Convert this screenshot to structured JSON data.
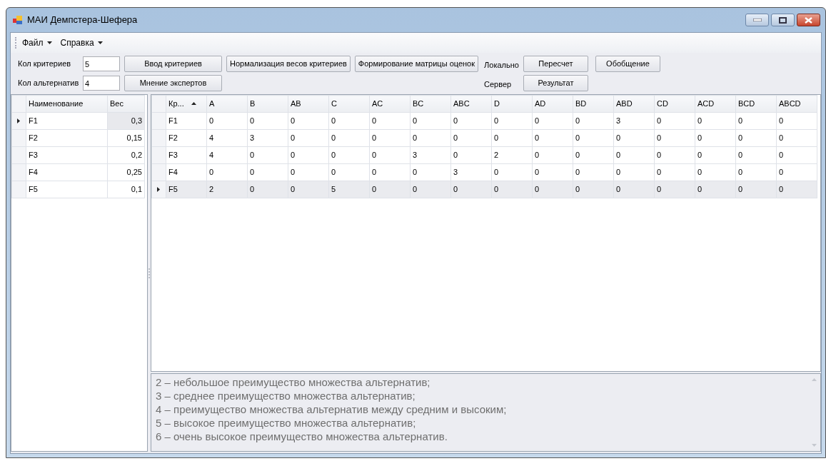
{
  "window": {
    "title": "МАИ Демпстера-Шефера"
  },
  "menu": [
    {
      "label": "Файл"
    },
    {
      "label": "Справка"
    }
  ],
  "fields": [
    {
      "label": "Кол критериев",
      "value": "5"
    },
    {
      "label": "Кол альтернатив",
      "value": "4"
    }
  ],
  "buttons": {
    "input_criteria": "Ввод критериев",
    "experts": "Мнение экспертов",
    "normalize": "Нормализация весов критериев",
    "matrix": "Формирование матрицы оценок",
    "local_label": "Локально",
    "server_label": "Сервер",
    "recalc": "Пересчет",
    "result": "Результат",
    "summary": "Обобщение"
  },
  "criteria_grid": {
    "columns": [
      "Наименование",
      "Вес"
    ],
    "rows": [
      {
        "current": true,
        "cells": [
          {
            "text": "F1",
            "selected": false
          },
          {
            "text": "0,3",
            "selected": true
          }
        ]
      },
      {
        "current": false,
        "cells": [
          {
            "text": "F2",
            "selected": false
          },
          {
            "text": "0,15",
            "selected": false
          }
        ]
      },
      {
        "current": false,
        "cells": [
          {
            "text": "F3",
            "selected": false
          },
          {
            "text": "0,2",
            "selected": false
          }
        ]
      },
      {
        "current": false,
        "cells": [
          {
            "text": "F4",
            "selected": false
          },
          {
            "text": "0,25",
            "selected": false
          }
        ]
      },
      {
        "current": false,
        "cells": [
          {
            "text": "F5",
            "selected": false
          },
          {
            "text": "0,1",
            "selected": false
          }
        ]
      }
    ]
  },
  "matrix_grid": {
    "columns": [
      {
        "label": "Кр...",
        "sorted": true
      },
      {
        "label": "A",
        "sorted": false
      },
      {
        "label": "B",
        "sorted": false
      },
      {
        "label": "AB",
        "sorted": false
      },
      {
        "label": "C",
        "sorted": false
      },
      {
        "label": "AC",
        "sorted": false
      },
      {
        "label": "BC",
        "sorted": false
      },
      {
        "label": "ABC",
        "sorted": false
      },
      {
        "label": "D",
        "sorted": false
      },
      {
        "label": "AD",
        "sorted": false
      },
      {
        "label": "BD",
        "sorted": false
      },
      {
        "label": "ABD",
        "sorted": false
      },
      {
        "label": "CD",
        "sorted": false
      },
      {
        "label": "ACD",
        "sorted": false
      },
      {
        "label": "BCD",
        "sorted": false
      },
      {
        "label": "ABCD",
        "sorted": false
      }
    ],
    "rows": [
      {
        "current": false,
        "selected": false,
        "cells": [
          "F1",
          "0",
          "0",
          "0",
          "0",
          "0",
          "0",
          "0",
          "0",
          "0",
          "0",
          "3",
          "0",
          "0",
          "0",
          "0"
        ]
      },
      {
        "current": false,
        "selected": false,
        "cells": [
          "F2",
          "4",
          "3",
          "0",
          "0",
          "0",
          "0",
          "0",
          "0",
          "0",
          "0",
          "0",
          "0",
          "0",
          "0",
          "0"
        ]
      },
      {
        "current": false,
        "selected": false,
        "cells": [
          "F3",
          "4",
          "0",
          "0",
          "0",
          "0",
          "3",
          "0",
          "2",
          "0",
          "0",
          "0",
          "0",
          "0",
          "0",
          "0"
        ]
      },
      {
        "current": false,
        "selected": false,
        "cells": [
          "F4",
          "0",
          "0",
          "0",
          "0",
          "0",
          "0",
          "3",
          "0",
          "0",
          "0",
          "0",
          "0",
          "0",
          "0",
          "0"
        ]
      },
      {
        "current": true,
        "selected": true,
        "cells": [
          "F5",
          "2",
          "0",
          "0",
          "5",
          "0",
          "0",
          "0",
          "0",
          "0",
          "0",
          "0",
          "0",
          "0",
          "0",
          "0"
        ]
      }
    ]
  },
  "notes": [
    "2 – небольшое преимущество множества альтернатив;",
    "3 – среднее преимущество множества альтернатив;",
    "4 – преимущество множества альтернатив между средним и высоким;",
    "5 – высокое преимущество множества альтернатив;",
    "6 – очень высокое преимущество множества альтернатив."
  ]
}
